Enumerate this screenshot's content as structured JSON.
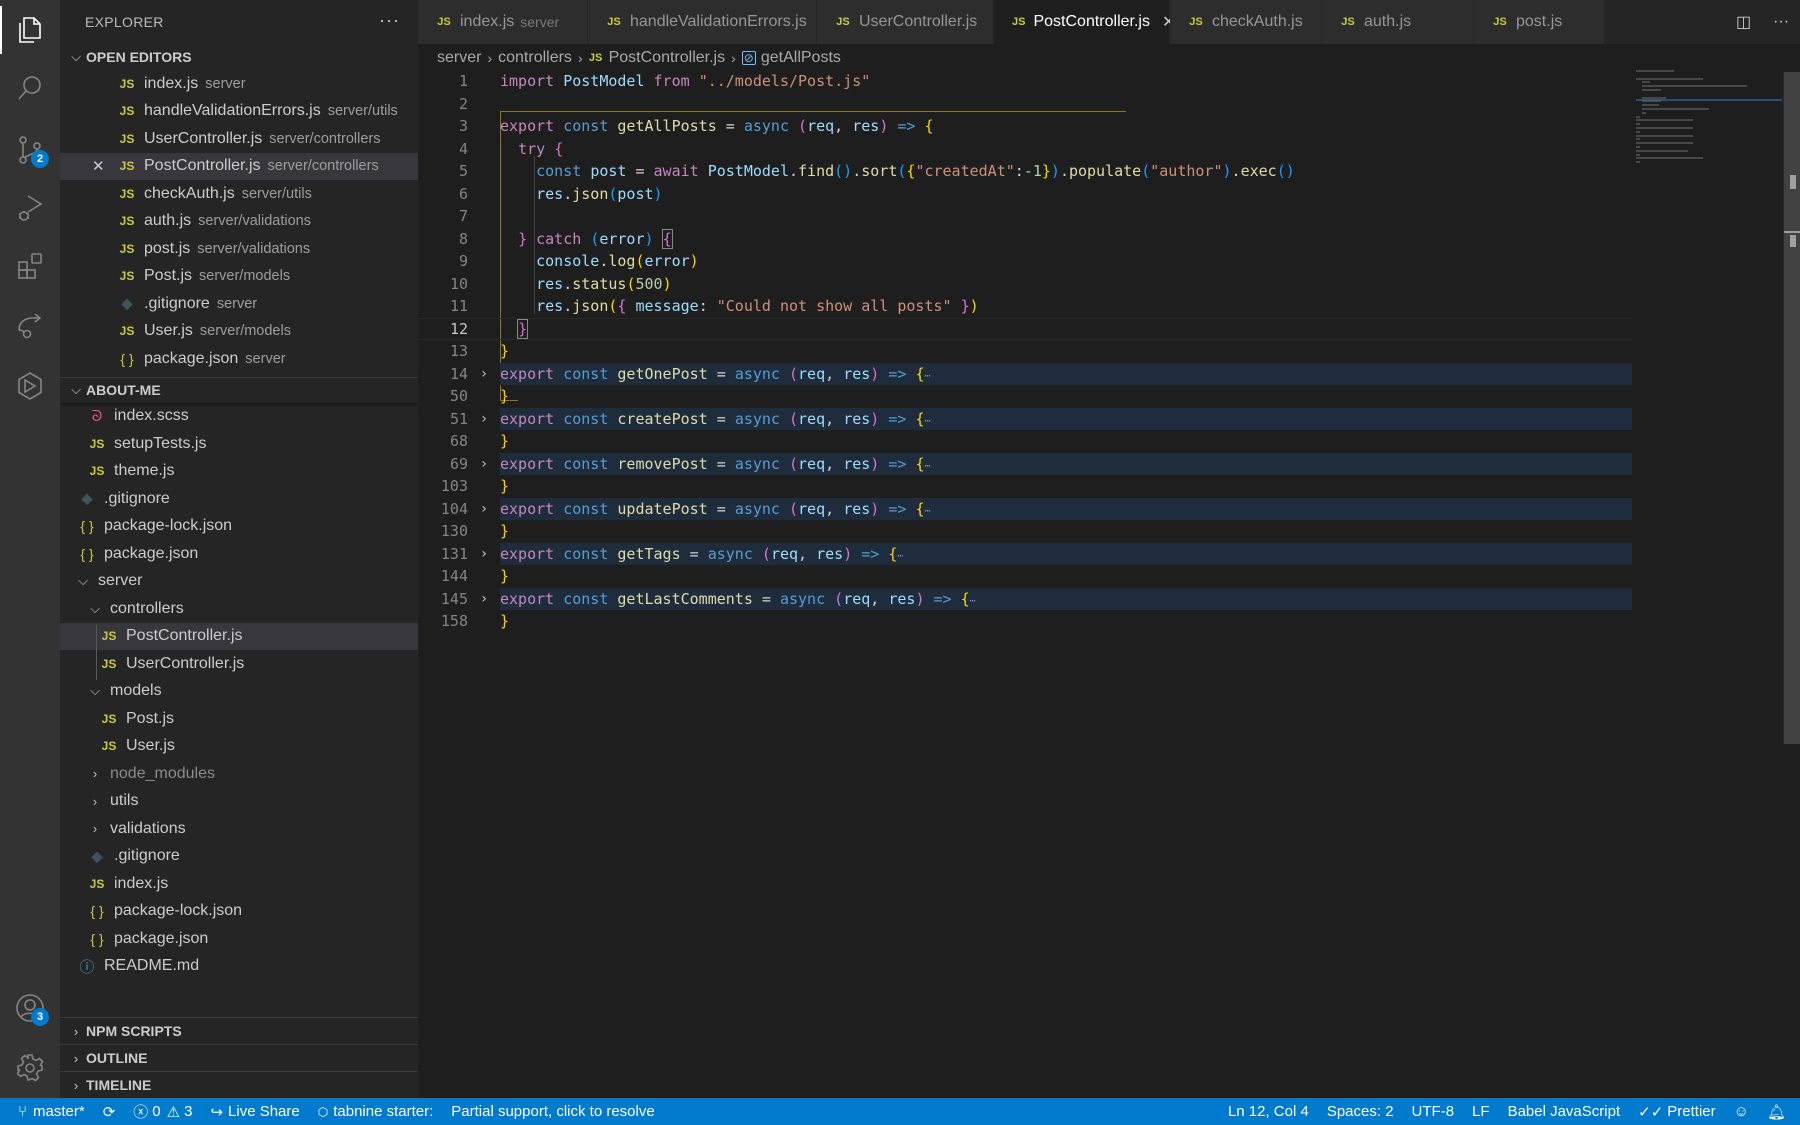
{
  "activity_bar": {
    "items": [
      {
        "name": "explorer",
        "icon": "files-icon",
        "active": true
      },
      {
        "name": "search",
        "icon": "search-icon"
      },
      {
        "name": "source-control",
        "icon": "source-control-icon",
        "badge": "2"
      },
      {
        "name": "run-debug",
        "icon": "run-debug-icon"
      },
      {
        "name": "extensions",
        "icon": "extensions-icon"
      },
      {
        "name": "live-share",
        "icon": "live-share-icon"
      },
      {
        "name": "tabnine",
        "icon": "tabnine-icon"
      }
    ],
    "accounts_badge": "3"
  },
  "sidebar": {
    "title": "EXPLORER",
    "more_label": "···",
    "open_editors": {
      "header": "OPEN EDITORS",
      "items": [
        {
          "name": "index.js",
          "desc": "server",
          "type": "js"
        },
        {
          "name": "handleValidationErrors.js",
          "desc": "server/utils",
          "type": "js"
        },
        {
          "name": "UserController.js",
          "desc": "server/controllers",
          "type": "js"
        },
        {
          "name": "PostController.js",
          "desc": "server/controllers",
          "type": "js",
          "selected": true
        },
        {
          "name": "checkAuth.js",
          "desc": "server/utils",
          "type": "js"
        },
        {
          "name": "auth.js",
          "desc": "server/validations",
          "type": "js"
        },
        {
          "name": "post.js",
          "desc": "server/validations",
          "type": "js"
        },
        {
          "name": "Post.js",
          "desc": "server/models",
          "type": "js"
        },
        {
          "name": ".gitignore",
          "desc": "server",
          "type": "git"
        },
        {
          "name": "User.js",
          "desc": "server/models",
          "type": "js"
        },
        {
          "name": "package.json",
          "desc": "server",
          "type": "json"
        }
      ]
    },
    "workspace": {
      "header": "ABOUT-ME",
      "items": [
        {
          "name": "index.scss",
          "type": "scss",
          "depth": 2
        },
        {
          "name": "setupTests.js",
          "type": "js",
          "depth": 2
        },
        {
          "name": "theme.js",
          "type": "js",
          "depth": 2
        },
        {
          "name": ".gitignore",
          "type": "git",
          "depth": 1
        },
        {
          "name": "package-lock.json",
          "type": "json",
          "depth": 1
        },
        {
          "name": "package.json",
          "type": "json",
          "depth": 1
        },
        {
          "name": "server",
          "type": "folder-open",
          "depth": 1
        },
        {
          "name": "controllers",
          "type": "folder-open",
          "depth": 2
        },
        {
          "name": "PostController.js",
          "type": "js",
          "depth": 3,
          "selected": true
        },
        {
          "name": "UserController.js",
          "type": "js",
          "depth": 3
        },
        {
          "name": "models",
          "type": "folder-open",
          "depth": 2
        },
        {
          "name": "Post.js",
          "type": "js",
          "depth": 3
        },
        {
          "name": "User.js",
          "type": "js",
          "depth": 3
        },
        {
          "name": "node_modules",
          "type": "folder-closed",
          "depth": 2,
          "muted": true
        },
        {
          "name": "utils",
          "type": "folder-closed",
          "depth": 2
        },
        {
          "name": "validations",
          "type": "folder-closed",
          "depth": 2
        },
        {
          "name": ".gitignore",
          "type": "git",
          "depth": 2
        },
        {
          "name": "index.js",
          "type": "js",
          "depth": 2
        },
        {
          "name": "package-lock.json",
          "type": "json",
          "depth": 2
        },
        {
          "name": "package.json",
          "type": "json",
          "depth": 2
        },
        {
          "name": "README.md",
          "type": "info",
          "depth": 1
        }
      ]
    },
    "bottom_sections": [
      "NPM SCRIPTS",
      "OUTLINE",
      "TIMELINE"
    ]
  },
  "tabs": [
    {
      "label": "index.js",
      "desc": "server"
    },
    {
      "label": "handleValidationErrors.js"
    },
    {
      "label": "UserController.js"
    },
    {
      "label": "PostController.js",
      "active": true,
      "close": "✕"
    },
    {
      "label": "checkAuth.js"
    },
    {
      "label": "auth.js"
    },
    {
      "label": "post.js"
    }
  ],
  "tab_actions": {
    "split": "split-editor-icon",
    "more": "···"
  },
  "breadcrumb": [
    "server",
    "controllers",
    "PostController.js",
    "getAllPosts"
  ],
  "editor": {
    "current_line": 12,
    "lines": [
      {
        "n": "1"
      },
      {
        "n": "2"
      },
      {
        "n": "3"
      },
      {
        "n": "4"
      },
      {
        "n": "5"
      },
      {
        "n": "6"
      },
      {
        "n": "7"
      },
      {
        "n": "8"
      },
      {
        "n": "9"
      },
      {
        "n": "10"
      },
      {
        "n": "11"
      },
      {
        "n": "12"
      },
      {
        "n": "13"
      },
      {
        "n": "14",
        "folded": true
      },
      {
        "n": "50"
      },
      {
        "n": "51",
        "folded": true
      },
      {
        "n": "68"
      },
      {
        "n": "69",
        "folded": true
      },
      {
        "n": "103"
      },
      {
        "n": "104",
        "folded": true
      },
      {
        "n": "130"
      },
      {
        "n": "131",
        "folded": true
      },
      {
        "n": "144"
      },
      {
        "n": "145",
        "folded": true
      },
      {
        "n": "158"
      }
    ],
    "tokens": {
      "import": "import",
      "PostModel": "PostModel",
      "from": "from",
      "path": "\"../models/Post.js\"",
      "export": "export",
      "const": "const",
      "getAllPosts": "getAllPosts",
      "eq": "=",
      "async": "async",
      "req": "req",
      "res": "res",
      "arrow": "=>",
      "try": "try",
      "post": "post",
      "await": "await",
      "find": "find",
      "sort": "sort",
      "createdAt": "\"createdAt\"",
      "minus1": "-1",
      "populate": "populate",
      "author": "\"author\"",
      "exec": "exec",
      "json": "json",
      "catch": "catch",
      "error": "error",
      "console": "console",
      "log": "log",
      "status": "status",
      "n500": "500",
      "message": "message",
      "msg": "\"Could not show all posts\"",
      "getOnePost": "getOnePost",
      "createPost": "createPost",
      "removePost": "removePost",
      "updatePost": "updatePost",
      "getTags": "getTags",
      "getLastComments": "getLastComments",
      "ellipsis": "⋯"
    }
  },
  "statusbar": {
    "branch": "master*",
    "errors": "0",
    "warnings": "3",
    "live_share": "Live Share",
    "tabnine": "tabnine starter:",
    "tabnine_msg": "Partial support, click to resolve",
    "position": "Ln 12, Col 4",
    "spaces": "Spaces: 2",
    "encoding": "UTF-8",
    "eol": "LF",
    "language": "Babel JavaScript",
    "formatter": "Prettier"
  }
}
